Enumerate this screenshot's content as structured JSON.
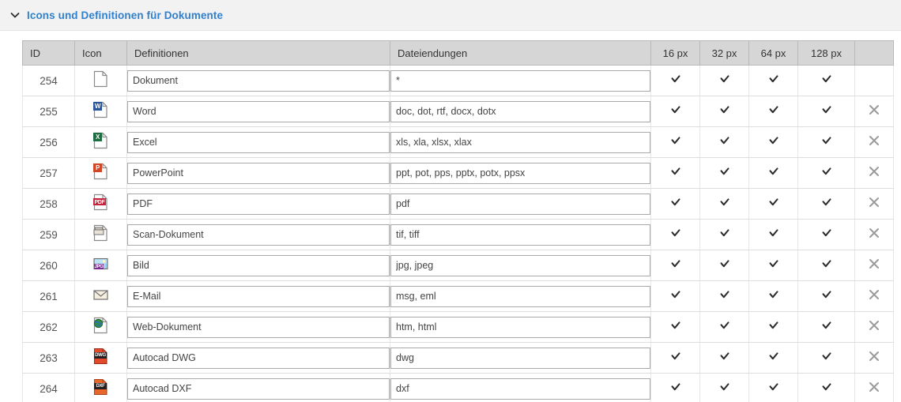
{
  "panel": {
    "title": "Icons und Definitionen für Dokumente",
    "chevron_icon": "chevron-down-icon",
    "accent_color": "#3080d0",
    "header_bg": "#f2f2f2"
  },
  "table": {
    "header_bg": "#d6d6d6",
    "columns": [
      {
        "key": "id",
        "label": "ID"
      },
      {
        "key": "icon",
        "label": "Icon"
      },
      {
        "key": "definition",
        "label": "Definitionen"
      },
      {
        "key": "extensions",
        "label": "Dateiendungen"
      },
      {
        "key": "px16",
        "label": "16 px"
      },
      {
        "key": "px32",
        "label": "32 px"
      },
      {
        "key": "px64",
        "label": "64 px"
      },
      {
        "key": "px128",
        "label": "128 px"
      },
      {
        "key": "delete",
        "label": ""
      }
    ],
    "check_icon": "check-icon",
    "delete_icon": "close-x-icon",
    "rows": [
      {
        "id": "254",
        "icon": "document-blank-icon",
        "definition": "Dokument",
        "extensions": "*",
        "px16": true,
        "px32": true,
        "px64": true,
        "px128": true,
        "deletable": false
      },
      {
        "id": "255",
        "icon": "word-document-icon",
        "definition": "Word",
        "extensions": "doc, dot, rtf, docx, dotx",
        "px16": true,
        "px32": true,
        "px64": true,
        "px128": true,
        "deletable": true
      },
      {
        "id": "256",
        "icon": "excel-document-icon",
        "definition": "Excel",
        "extensions": "xls, xla, xlsx, xlax",
        "px16": true,
        "px32": true,
        "px64": true,
        "px128": true,
        "deletable": true
      },
      {
        "id": "257",
        "icon": "powerpoint-document-icon",
        "definition": "PowerPoint",
        "extensions": "ppt, pot, pps, pptx, potx, ppsx",
        "px16": true,
        "px32": true,
        "px64": true,
        "px128": true,
        "deletable": true
      },
      {
        "id": "258",
        "icon": "pdf-document-icon",
        "definition": "PDF",
        "extensions": "pdf",
        "px16": true,
        "px32": true,
        "px64": true,
        "px128": true,
        "deletable": true
      },
      {
        "id": "259",
        "icon": "scan-document-icon",
        "definition": "Scan-Dokument",
        "extensions": "tif, tiff",
        "px16": true,
        "px32": true,
        "px64": true,
        "px128": true,
        "deletable": true
      },
      {
        "id": "260",
        "icon": "image-jpg-icon",
        "definition": "Bild",
        "extensions": "jpg, jpeg",
        "px16": true,
        "px32": true,
        "px64": true,
        "px128": true,
        "deletable": true
      },
      {
        "id": "261",
        "icon": "email-envelope-icon",
        "definition": "E-Mail",
        "extensions": "msg, eml",
        "px16": true,
        "px32": true,
        "px64": true,
        "px128": true,
        "deletable": true
      },
      {
        "id": "262",
        "icon": "web-document-icon",
        "definition": "Web-Dokument",
        "extensions": "htm, html",
        "px16": true,
        "px32": true,
        "px64": true,
        "px128": true,
        "deletable": true
      },
      {
        "id": "263",
        "icon": "autocad-dwg-icon",
        "definition": "Autocad DWG",
        "extensions": "dwg",
        "px16": true,
        "px32": true,
        "px64": true,
        "px128": true,
        "deletable": true
      },
      {
        "id": "264",
        "icon": "autocad-dxf-icon",
        "definition": "Autocad DXF",
        "extensions": "dxf",
        "px16": true,
        "px32": true,
        "px64": true,
        "px128": true,
        "deletable": true
      }
    ]
  }
}
